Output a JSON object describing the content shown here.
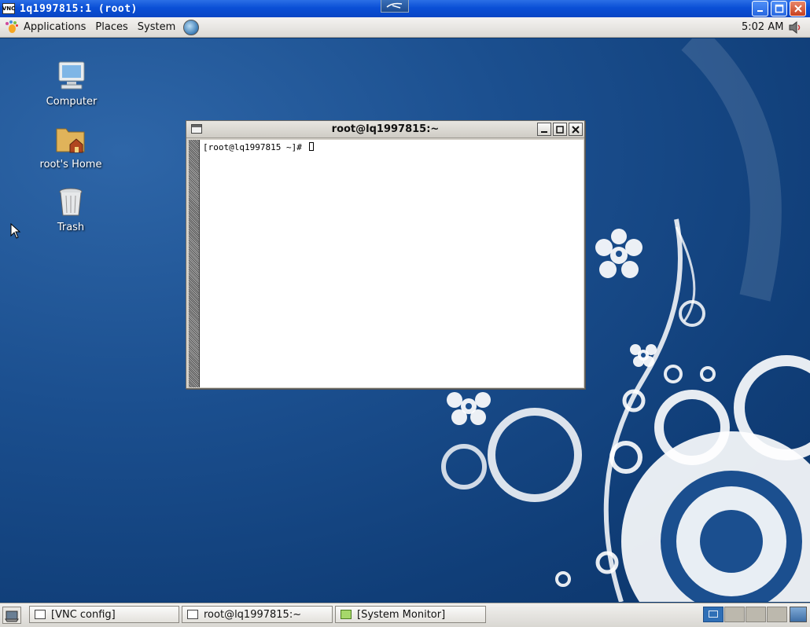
{
  "vnc_window": {
    "title": "1q1997815:1 (root)",
    "logo_text": "VNC"
  },
  "top_panel": {
    "menus": [
      "Applications",
      "Places",
      "System"
    ],
    "clock": "5:02 AM"
  },
  "desktop": {
    "icons": [
      {
        "label": "Computer"
      },
      {
        "label": "root's Home"
      },
      {
        "label": "Trash"
      }
    ]
  },
  "terminal": {
    "title": "root@lq1997815:~",
    "prompt": "[root@lq1997815 ~]# "
  },
  "taskbar": {
    "tasks": [
      {
        "label": "[VNC config]"
      },
      {
        "label": "root@lq1997815:~"
      },
      {
        "label": "[System Monitor]"
      }
    ],
    "workspace_count": 4,
    "active_workspace": 1
  },
  "colors": {
    "desktop_blue": "#1b4f8f",
    "vnc_titlebar": "#0a4fd6",
    "panel_gray": "#dcdad5",
    "active_workspace": "#2f6fb6"
  }
}
